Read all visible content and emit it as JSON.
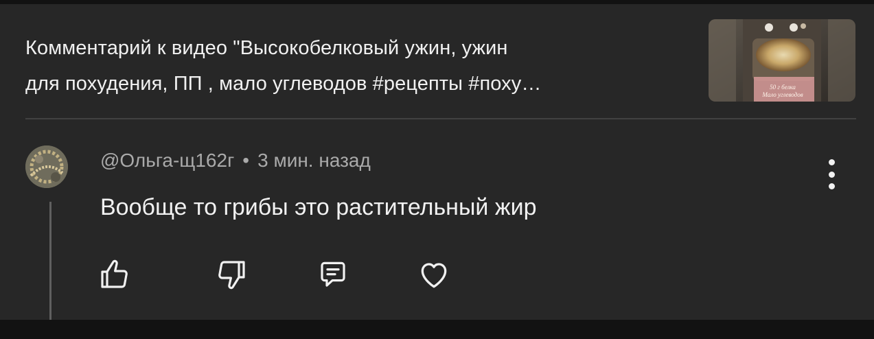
{
  "context": {
    "title_line1": "Комментарий к видео \"Высокобелковый ужин, ужин",
    "title_line2": "для похудения, ПП , мало углеводов #рецепты #поху…",
    "thumbnail": {
      "caption_line1": "50 г белка",
      "caption_line2": "Мало углеводов"
    }
  },
  "comment": {
    "author": "@Ольга-щ162г",
    "separator": "•",
    "time": "3 мин. назад",
    "text": "Вообще то грибы это растительный жир"
  },
  "actions": {
    "like_icon": "thumb-up-icon",
    "dislike_icon": "thumb-down-icon",
    "reply_icon": "reply-icon",
    "heart_icon": "heart-icon",
    "more_icon": "more-vertical-icon"
  },
  "colors": {
    "background": "#121212",
    "card": "#272727",
    "text_primary": "#f1f1f1",
    "text_secondary": "#aaaaaa",
    "divider": "#414141"
  }
}
